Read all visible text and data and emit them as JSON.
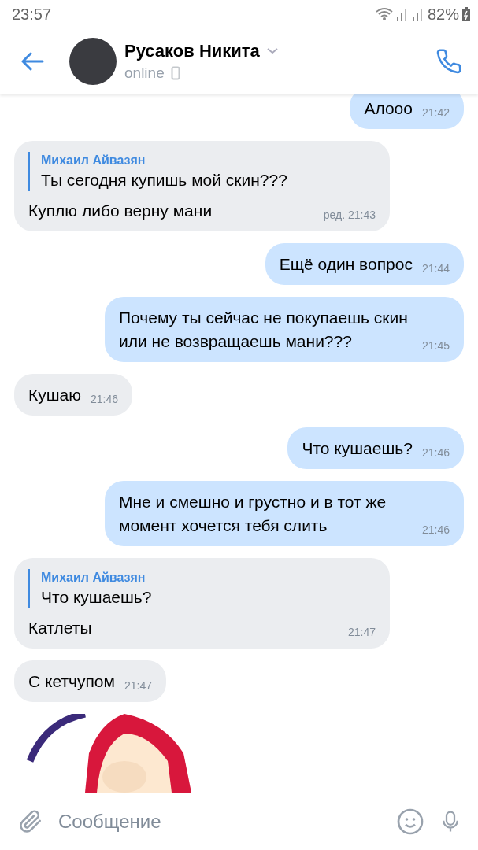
{
  "status_bar": {
    "time": "23:57",
    "battery": "82%"
  },
  "header": {
    "name": "Русаков Никита",
    "status": "online"
  },
  "messages": [
    {
      "outgoing": true,
      "text": "Алооо",
      "time": "21:42"
    },
    {
      "outgoing": false,
      "reply": {
        "author": "Михаил Айвазян",
        "text": "Ты сегодня купишь мой скин???"
      },
      "text": "Куплю либо верну мани",
      "time": "ред. 21:43"
    },
    {
      "outgoing": true,
      "text": "Ещё один вопрос",
      "time": "21:44"
    },
    {
      "outgoing": true,
      "text": "Почему ты сейчас не покупаешь скин или не возвращаешь мани???",
      "time": "21:45"
    },
    {
      "outgoing": false,
      "text": "Кушаю",
      "time": "21:46"
    },
    {
      "outgoing": true,
      "text": "Что кушаешь?",
      "time": "21:46"
    },
    {
      "outgoing": true,
      "text": "Мне и смешно и грустно и в тот же момент хочется тебя слить",
      "time": "21:46"
    },
    {
      "outgoing": false,
      "reply": {
        "author": "Михаил Айвазян",
        "text": "Что кушаешь?"
      },
      "text": "Катлеты",
      "time": "21:47"
    },
    {
      "outgoing": false,
      "text": "С кетчупом",
      "time": "21:47"
    },
    {
      "outgoing": false,
      "kind": "picture"
    }
  ],
  "composer": {
    "placeholder": "Сообщение"
  }
}
